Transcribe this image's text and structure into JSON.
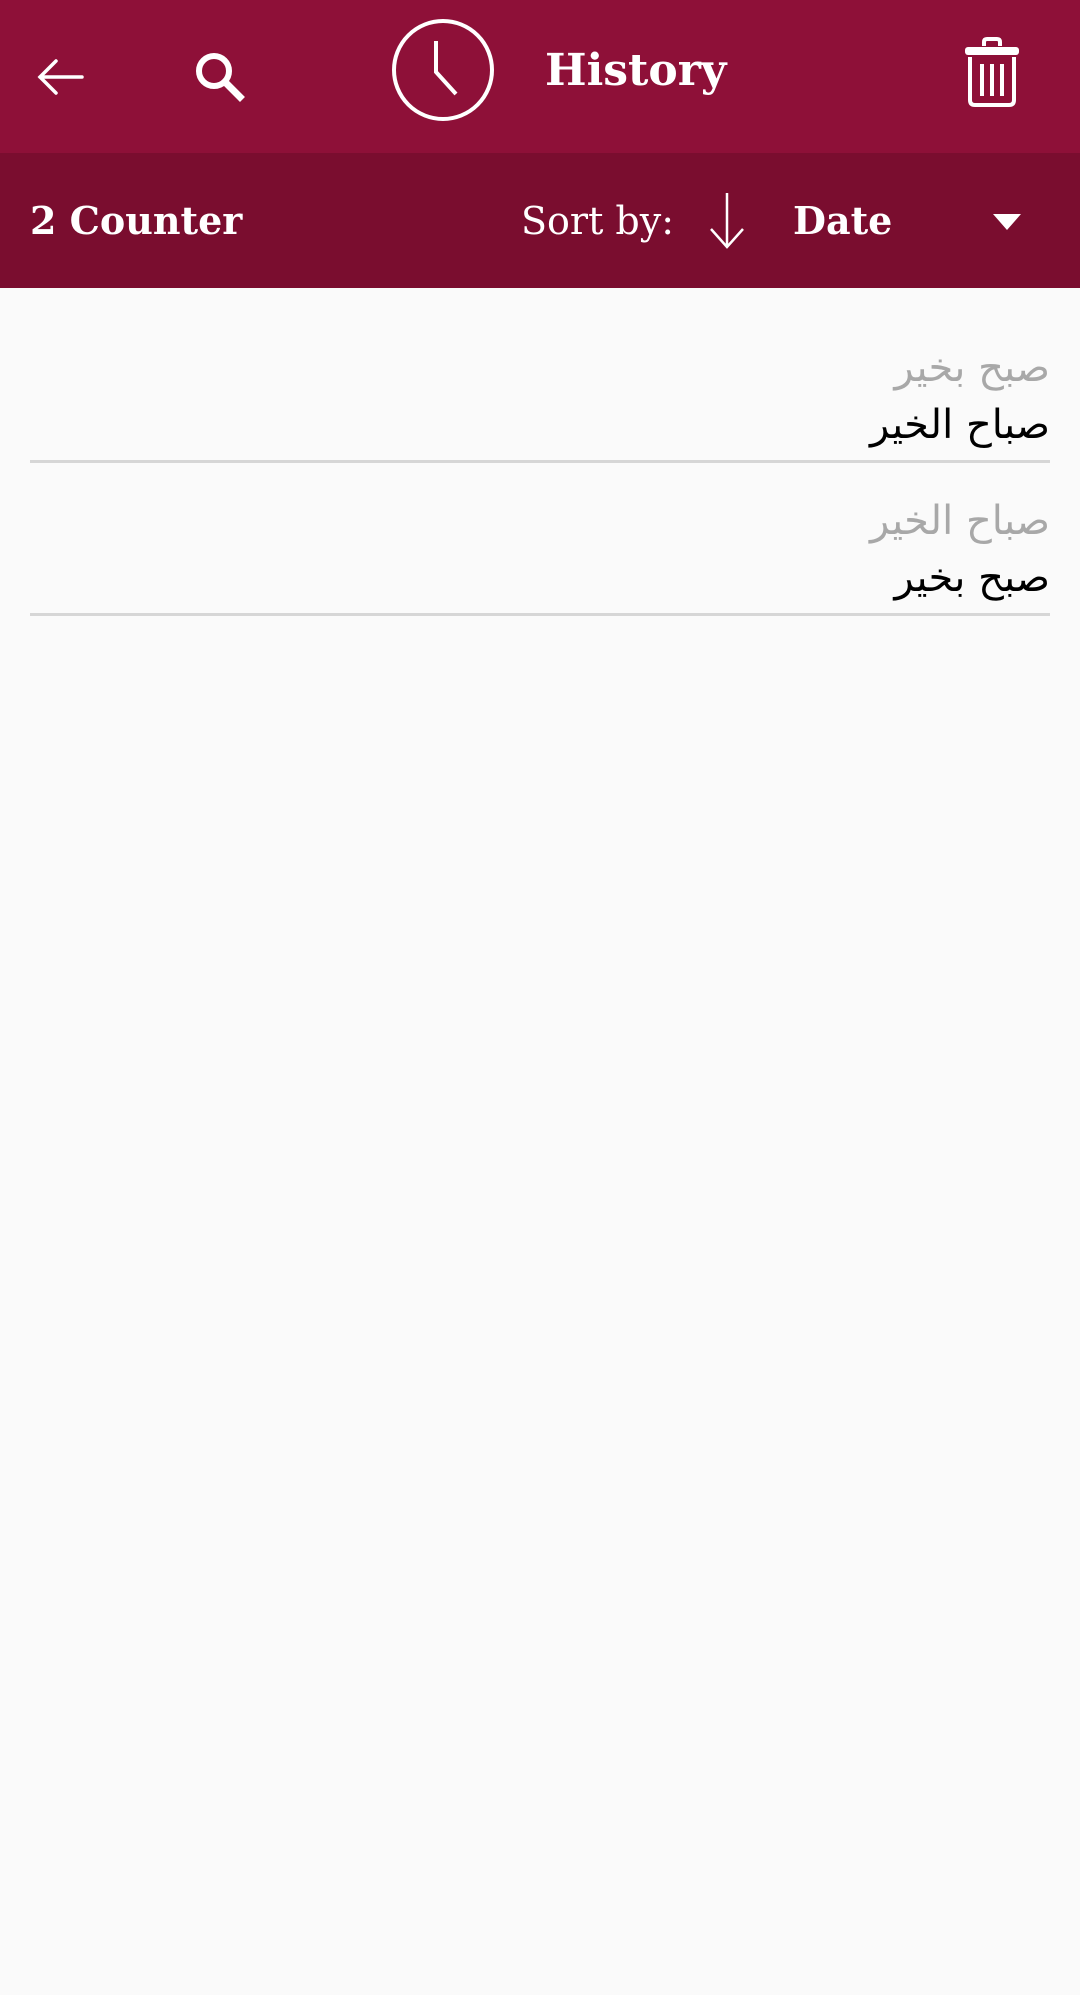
{
  "colors": {
    "appbar": "#8e1038",
    "subbar": "#7a0d2f",
    "background": "#fafafa"
  },
  "header": {
    "back_icon": "arrow-left-icon",
    "search_icon": "search-icon",
    "history_icon": "clock-icon",
    "title": "History",
    "delete_icon": "trash-icon"
  },
  "toolbar": {
    "count_label": "2 Counter",
    "sort_label": "Sort by:",
    "sort_direction_icon": "arrow-down-icon",
    "sort_value": "Date",
    "dropdown_icon": "triangle-down-icon"
  },
  "history": [
    {
      "source": "صبح بخير",
      "translation": "صباح الخير"
    },
    {
      "source": "صباح الخير",
      "translation": "صبح بخير"
    }
  ]
}
